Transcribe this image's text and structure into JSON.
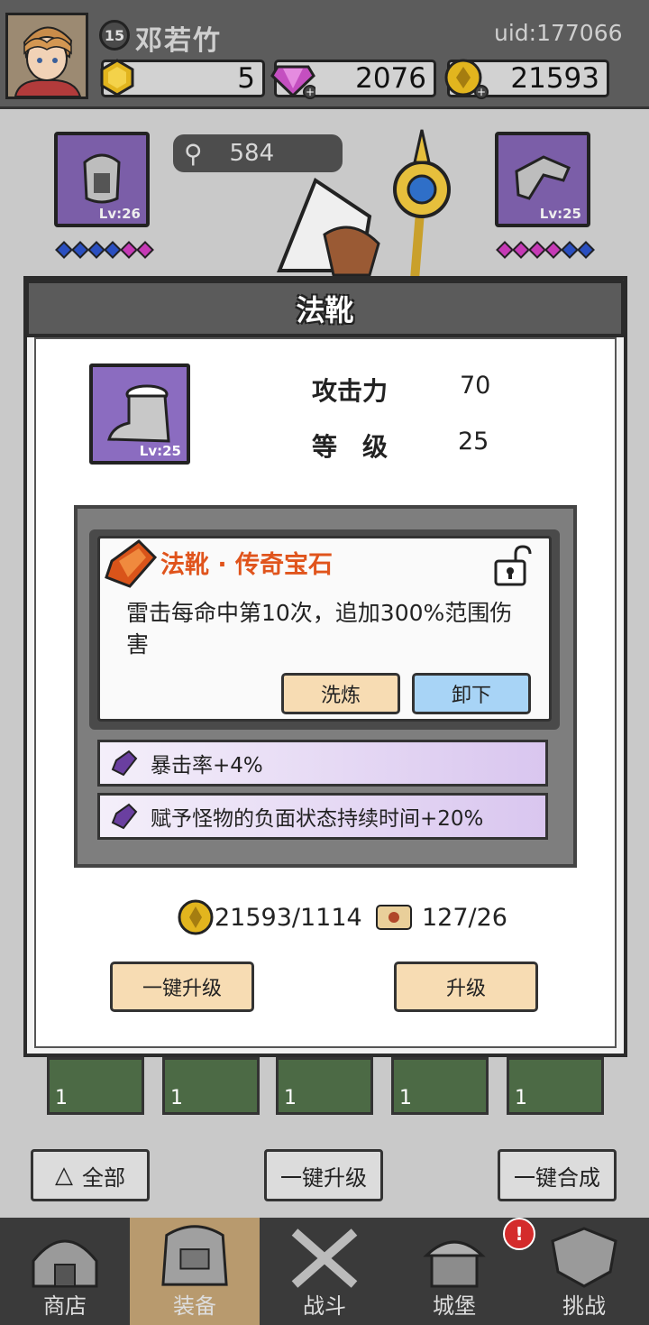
{
  "player": {
    "level": "15",
    "name": "邓若竹",
    "uid": "uid:177066",
    "energy": "5",
    "gems": "2076",
    "gold": "21593"
  },
  "hero": {
    "power": "584",
    "left_slot_level": "Lv:26",
    "right_slot_level": "Lv:25"
  },
  "modal": {
    "title": "法靴",
    "item_level_badge": "Lv:25",
    "stats": [
      {
        "label": "攻击力",
        "value": "70"
      },
      {
        "label": "等　级",
        "value": "25"
      }
    ],
    "gem": {
      "title": "法靴 · 传奇宝石",
      "description": "雷击每命中第10次，追加300%范围伤害",
      "refine_label": "洗炼",
      "unequip_label": "卸下"
    },
    "affixes": [
      {
        "text": "暴击率+4%"
      },
      {
        "text": "赋予怪物的负面状态持续时间+20%"
      }
    ],
    "cost_gold": "21593/1114",
    "cost_scroll": "127/26",
    "one_key_upgrade": "一键升级",
    "upgrade": "升级"
  },
  "inventory": {
    "count_label": "1"
  },
  "bottom_actions": {
    "all": "全部",
    "one_key_upgrade": "一键升级",
    "one_key_merge": "一键合成"
  },
  "nav": [
    {
      "label": "商店"
    },
    {
      "label": "装备"
    },
    {
      "label": "战斗"
    },
    {
      "label": "城堡"
    },
    {
      "label": "挑战"
    }
  ],
  "colors": {
    "gem_title": "#e0541c",
    "slot_purple": "#7b5ea8",
    "refine_button": "#f7dcb3",
    "unequip_button": "#a8d4f6"
  }
}
